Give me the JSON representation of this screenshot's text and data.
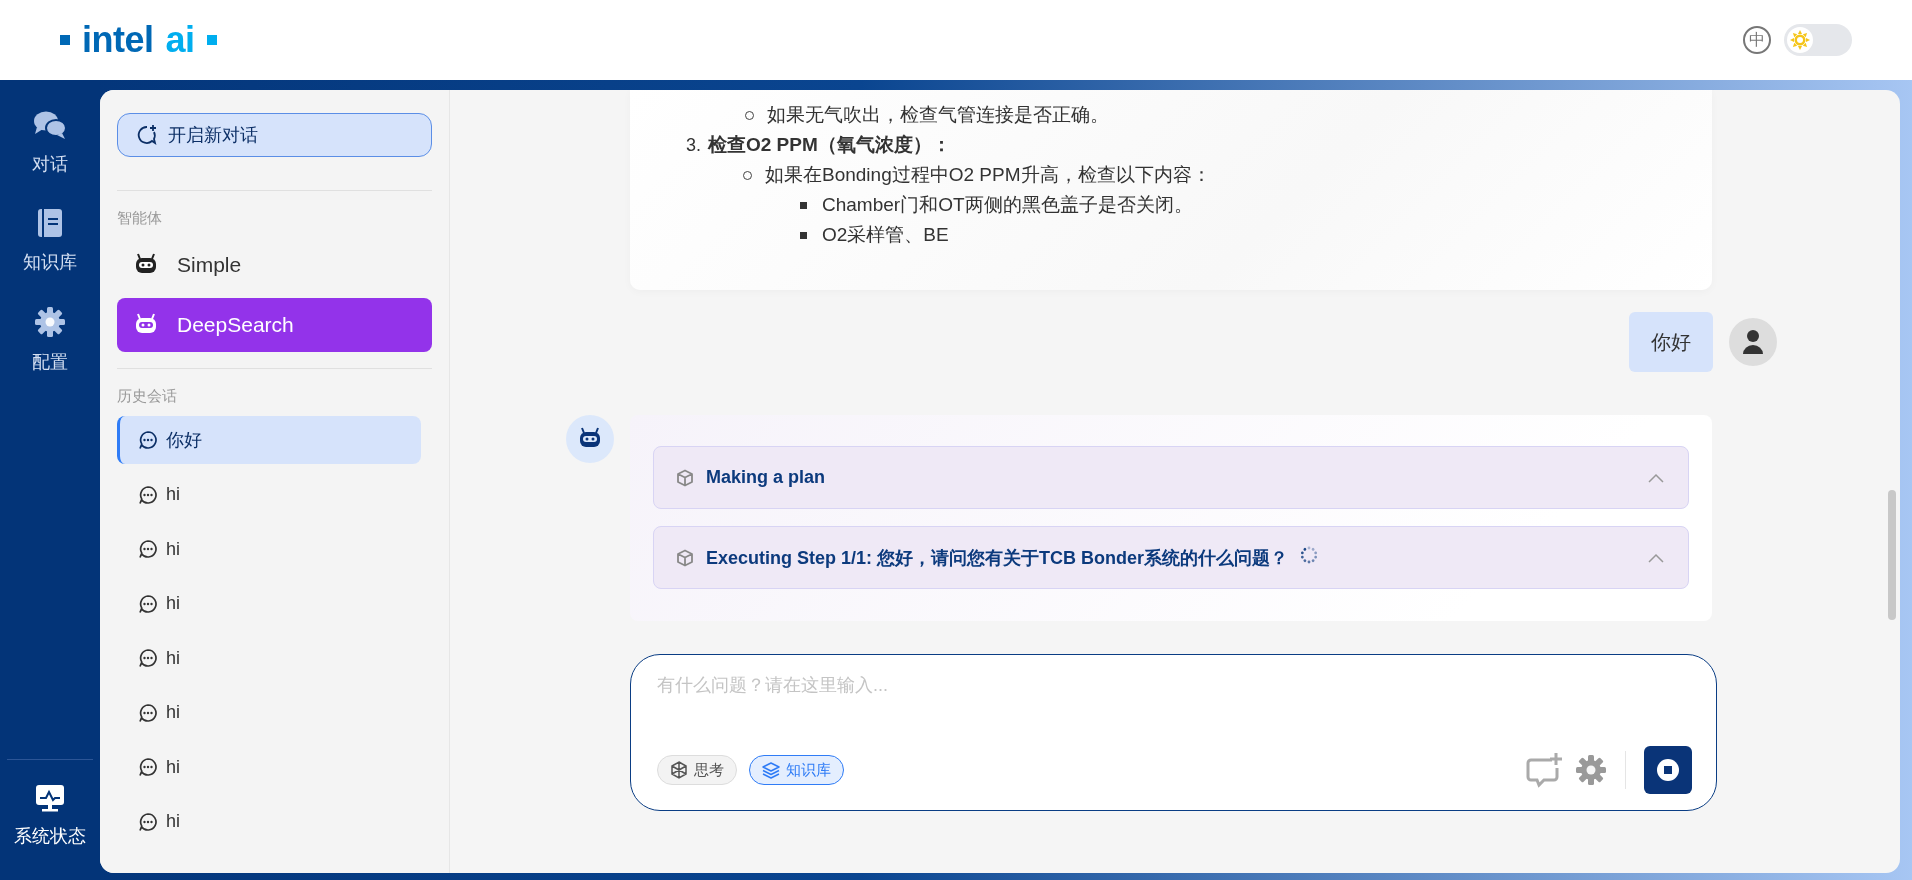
{
  "header": {
    "logo": {
      "brand": "intel",
      "suffix": "ai"
    },
    "language_button": "中",
    "theme_toggle": {
      "dark_mode": false
    }
  },
  "nav": {
    "items": [
      {
        "label": "对话"
      },
      {
        "label": "知识库"
      },
      {
        "label": "配置"
      }
    ],
    "footer": {
      "label": "系统状态"
    }
  },
  "sidebar": {
    "new_chat_button": "开启新对话",
    "agents_heading": "智能体",
    "agents": [
      {
        "name": "Simple",
        "selected": false
      },
      {
        "name": "DeepSearch",
        "selected": true
      }
    ],
    "history_heading": "历史会话",
    "history": [
      {
        "title": "你好",
        "selected": true
      },
      {
        "title": "hi",
        "selected": false
      },
      {
        "title": "hi",
        "selected": false
      },
      {
        "title": "hi",
        "selected": false
      },
      {
        "title": "hi",
        "selected": false
      },
      {
        "title": "hi",
        "selected": false
      },
      {
        "title": "hi",
        "selected": false
      },
      {
        "title": "hi",
        "selected": false
      }
    ]
  },
  "chat": {
    "answer": [
      {
        "kind": "circle",
        "text": "如果无气吹出，检查气管连接是否正确。"
      },
      {
        "kind": "numbered",
        "number": "3.",
        "text": "检查O2 PPM（氧气浓度）：",
        "children": [
          {
            "kind": "circle",
            "text": "如果在Bonding过程中O2 PPM升高，检查以下内容：",
            "children": [
              {
                "kind": "square",
                "text": "Chamber门和OT两侧的黑色盖子是否关闭。"
              },
              {
                "kind": "square",
                "text": "O2采样管、BE"
              }
            ]
          }
        ]
      }
    ],
    "user_message": "你好",
    "steps": [
      {
        "title": "Making a plan",
        "running": false
      },
      {
        "title": "Executing Step 1/1: 您好，请问您有关于TCB Bonder系统的什么问题？",
        "running": true
      }
    ]
  },
  "input": {
    "placeholder": "有什么问题？请在这里输入...",
    "chips": [
      {
        "label": "思考",
        "selected": false
      },
      {
        "label": "知识库",
        "selected": true
      }
    ],
    "generating": true
  }
}
